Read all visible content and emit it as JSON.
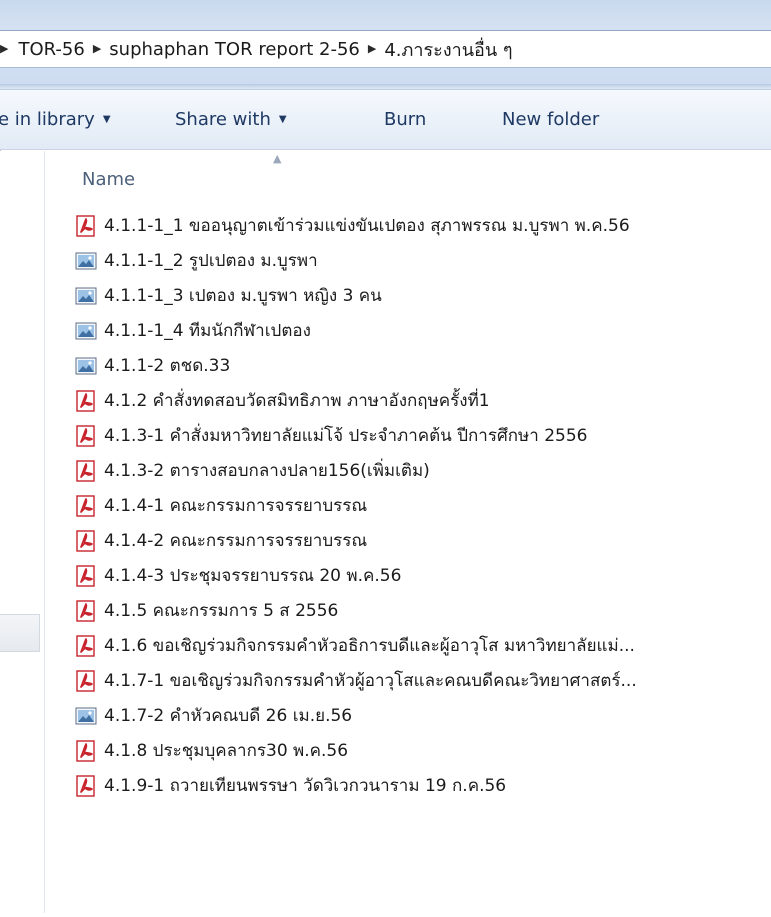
{
  "address": {
    "crumbs": [
      "TOR-56",
      "suphaphan TOR report 2-56",
      "4.ภาระงานอื่น ๆ"
    ]
  },
  "toolbar": {
    "include_label": "e in library",
    "share_label": "Share with",
    "burn_label": "Burn",
    "new_folder_label": "New folder"
  },
  "columns": {
    "name_header": "Name"
  },
  "files": [
    {
      "name": "4.1.1-1_1 ขออนุญาตเข้าร่วมแข่งขันเปตอง สุภาพรรณ ม.บูรพา พ.ค.56",
      "icon": "pdf-icon"
    },
    {
      "name": "4.1.1-1_2 รูปเปตอง ม.บูรพา",
      "icon": "image-icon"
    },
    {
      "name": "4.1.1-1_3 เปตอง ม.บูรพา หญิง 3 คน",
      "icon": "image-icon"
    },
    {
      "name": "4.1.1-1_4 ทีมนักกีฬาเปตอง",
      "icon": "image-icon"
    },
    {
      "name": "4.1.1-2 ตชด.33",
      "icon": "image-icon"
    },
    {
      "name": "4.1.2 คำสั่งทดสอบวัดสมิทธิภาพ ภาษาอังกฤษครั้งที่1",
      "icon": "pdf-icon"
    },
    {
      "name": "4.1.3-1 คำสั่งมหาวิทยาลัยแม่โจ้ ประจำภาคต้น ปีการศึกษา 2556",
      "icon": "pdf-icon"
    },
    {
      "name": "4.1.3-2 ตารางสอบกลางปลาย156(เพิ่มเติม)",
      "icon": "pdf-icon"
    },
    {
      "name": "4.1.4-1 คณะกรรมการจรรยาบรรณ",
      "icon": "pdf-icon"
    },
    {
      "name": "4.1.4-2 คณะกรรมการจรรยาบรรณ",
      "icon": "pdf-icon"
    },
    {
      "name": "4.1.4-3 ประชุมจรรยาบรรณ 20 พ.ค.56",
      "icon": "pdf-icon"
    },
    {
      "name": "4.1.5 คณะกรรมการ 5 ส 2556",
      "icon": "pdf-icon"
    },
    {
      "name": "4.1.6 ขอเชิญร่วมกิจกรรมคำหัวอธิการบดีและผู้อาวุโส มหาวิทยาลัยแม่...",
      "icon": "pdf-icon"
    },
    {
      "name": "4.1.7-1 ขอเชิญร่วมกิจกรรมคำหัวผู้อาวุโสและคณบดีคณะวิทยาศาสตร์...",
      "icon": "pdf-icon"
    },
    {
      "name": "4.1.7-2 คำหัวคณบดี 26 เม.ย.56",
      "icon": "image-icon"
    },
    {
      "name": "4.1.8 ประชุมบุคลากร30 พ.ค.56",
      "icon": "pdf-icon"
    },
    {
      "name": "4.1.9-1 ถวายเทียนพรรษา วัดวิเวกวนาราม 19 ก.ค.56",
      "icon": "pdf-icon"
    }
  ],
  "colors": {
    "pdf_red": "#c8232c",
    "toolbar_text": "#1e3963",
    "header_text": "#4c607a"
  }
}
